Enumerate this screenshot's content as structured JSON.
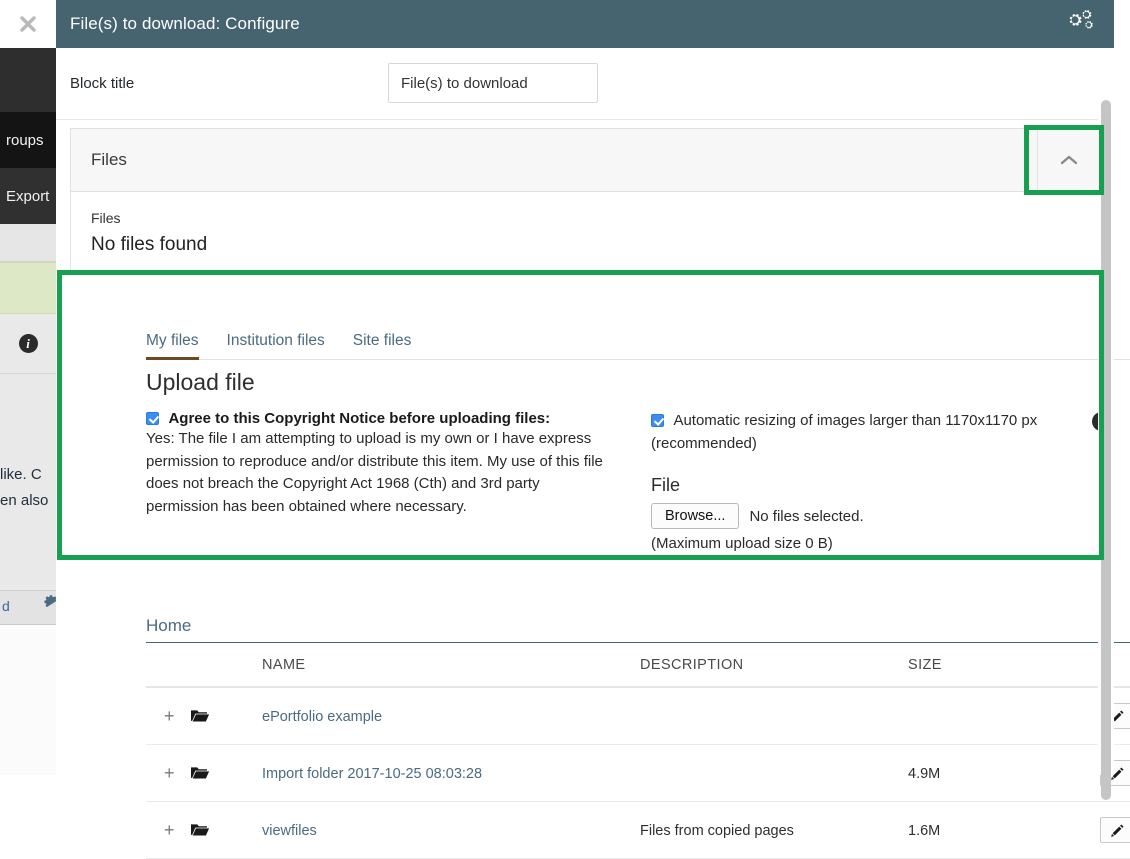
{
  "background": {
    "nav_items": [
      {
        "label": "roups",
        "name": "sidebar-item-groups"
      },
      {
        "label": "Export",
        "name": "sidebar-item-export"
      }
    ],
    "info_icon": "info-icon",
    "text_lines": [
      "like. C",
      "en also"
    ],
    "footer_link": "d",
    "footer_gear": "gear-icon"
  },
  "modal": {
    "title": "File(s) to download: Configure",
    "close_icon": "close-icon",
    "settings_icon": "cogs-icon",
    "block_title": {
      "label": "Block title",
      "value": "File(s) to download",
      "placeholder": "File(s) to download"
    },
    "files_panel": {
      "heading": "Files",
      "collapse_icon": "chevron-up-icon",
      "sublabel": "Files",
      "empty_text": "No files found"
    },
    "tabs": [
      {
        "label": "My files",
        "name": "tab-my-files",
        "active": true
      },
      {
        "label": "Institution files",
        "name": "tab-institution-files",
        "active": false
      },
      {
        "label": "Site files",
        "name": "tab-site-files",
        "active": false
      }
    ],
    "upload": {
      "title": "Upload file",
      "copyright": {
        "checked": true,
        "heading": "Agree to this Copyright Notice before uploading files:",
        "body": "Yes: The file I am attempting to upload is my own or I have express permission to reproduce and/or distribute this item. My use of this file does not breach the Copyright Act 1968 (Cth) and 3rd party permission has been obtained where necessary."
      },
      "resize": {
        "checked": true,
        "label": "Automatic resizing of images larger than 1170x1170 px (recommended)",
        "info_icon": "info-icon"
      },
      "file_field": {
        "heading": "File",
        "browse_label": "Browse...",
        "no_file_text": "No files selected.",
        "max_size_text": "(Maximum upload size 0 B)"
      }
    },
    "breadcrumb": "Home",
    "table": {
      "columns": [
        "NAME",
        "DESCRIPTION",
        "SIZE"
      ],
      "rows": [
        {
          "expand_icon": "plus-icon",
          "folder_icon": "folder-open-icon",
          "name": "ePortfolio example",
          "description": "",
          "size": "",
          "edit_icon": "pencil-icon"
        },
        {
          "expand_icon": "plus-icon",
          "folder_icon": "folder-open-icon",
          "name": "Import folder 2017-10-25 08:03:28",
          "description": "",
          "size": "4.9M",
          "edit_icon": "pencil-icon"
        },
        {
          "expand_icon": "plus-icon",
          "folder_icon": "folder-open-icon",
          "name": "viewfiles",
          "description": "Files from copied pages",
          "size": "1.6M",
          "edit_icon": "pencil-icon"
        }
      ]
    }
  },
  "colors": {
    "header_teal": "#46646f",
    "highlight_green": "#17a04f",
    "link_blue": "#4a6b82",
    "tab_active_underline": "#6b4a24",
    "checkbox_blue": "#3b8ef0"
  }
}
